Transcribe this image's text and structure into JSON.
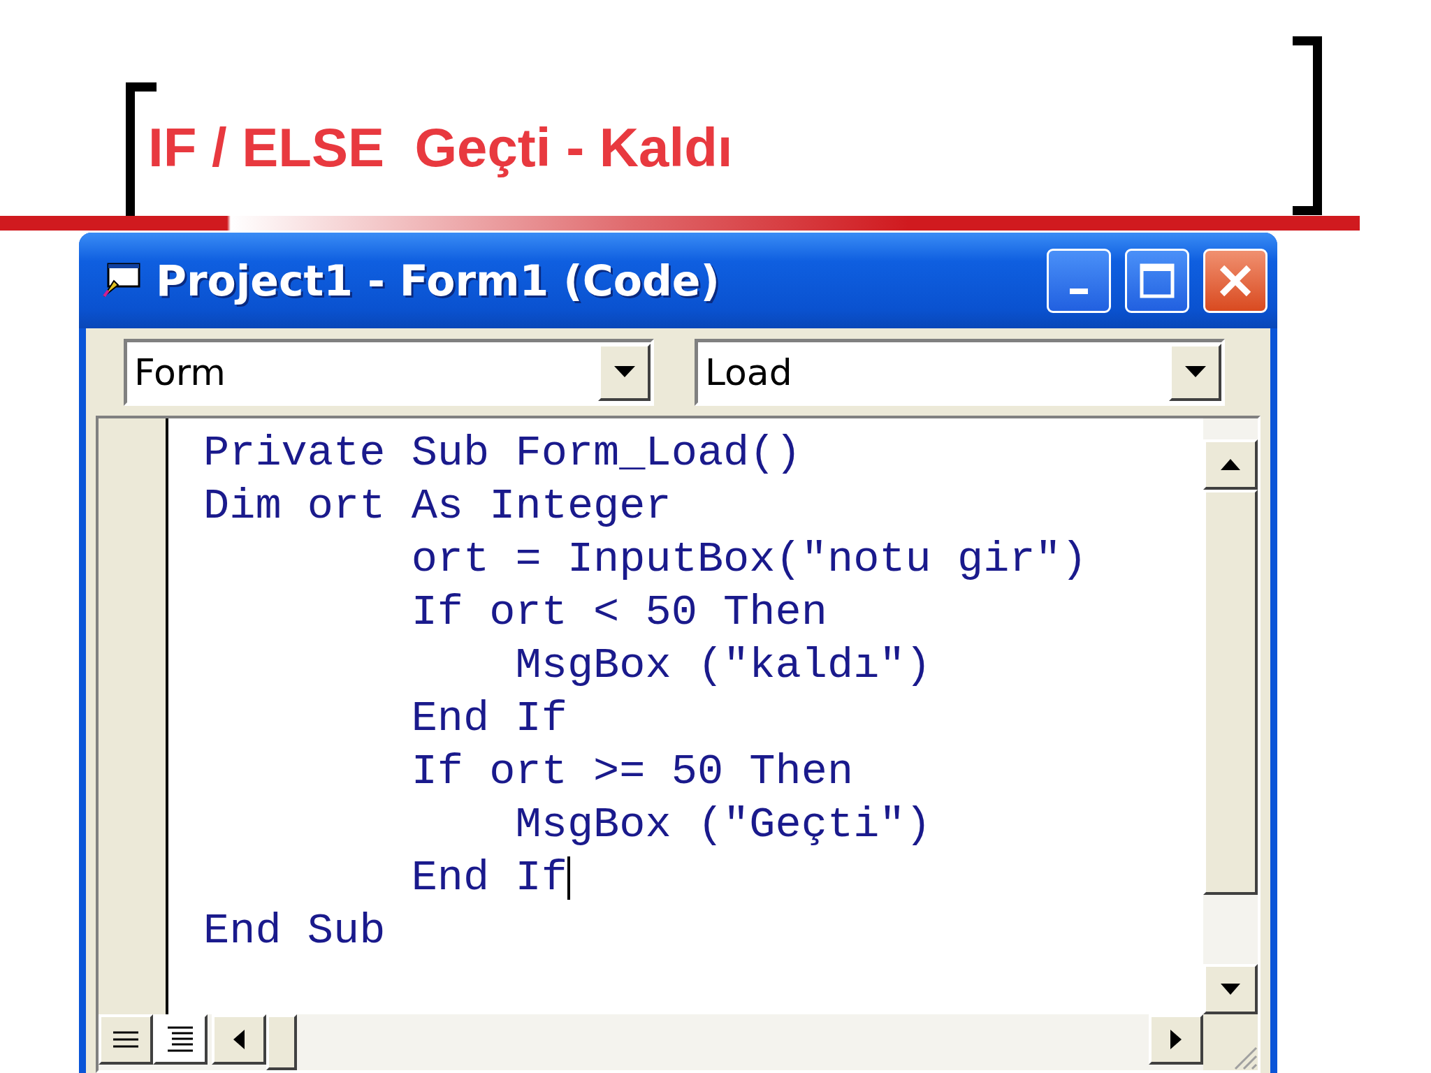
{
  "slide_title": "IF / ELSE  Geçti - Kaldı",
  "window": {
    "title": "Project1 - Form1 (Code)"
  },
  "object_combo": {
    "value": "Form"
  },
  "procedure_combo": {
    "value": "Load"
  },
  "code_lines": [
    {
      "text": "Private Sub Form_Load()",
      "cursor": false
    },
    {
      "text": "Dim ort As Integer",
      "cursor": false
    },
    {
      "text": "        ort = InputBox(\"notu gir\")",
      "cursor": false
    },
    {
      "text": "        If ort < 50 Then",
      "cursor": false
    },
    {
      "text": "            MsgBox (\"kaldı\")",
      "cursor": false
    },
    {
      "text": "        End If",
      "cursor": false
    },
    {
      "text": "        If ort >= 50 Then",
      "cursor": false
    },
    {
      "text": "            MsgBox (\"Geçti\")",
      "cursor": false
    },
    {
      "text": "        End If",
      "cursor": true
    },
    {
      "text": "End Sub",
      "cursor": false
    }
  ]
}
